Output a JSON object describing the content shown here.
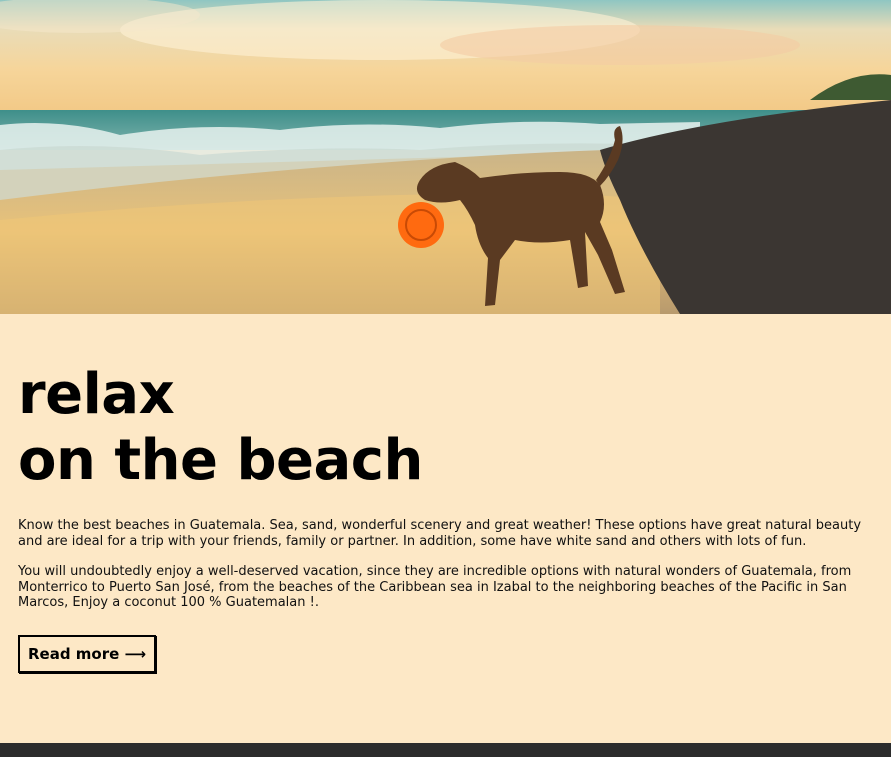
{
  "hero": {
    "image": "beach-dog-frisbee-photo"
  },
  "main": {
    "title_line1": "relax",
    "title_line2": "on the beach",
    "paragraph1": "Know the best beaches in Guatemala. Sea, sand, wonderful scenery and great weather! These options have great natural beauty and are ideal for a trip with your friends, family or partner. In addition, some have white sand and others with lots of fun.",
    "paragraph2": "You will undoubtedly enjoy a well-deserved vacation, since they are incredible options with natural wonders of Guatemala, from Monterrico to Puerto San José, from the beaches of the Caribbean sea in Izabal to the neighboring beaches of the Pacific in San Marcos, Enjoy a coconut 100 % Guatemalan !.",
    "read_more_label": "Read more ⟶"
  },
  "colors": {
    "background": "#fde8c6",
    "footer": "#2c2c2c",
    "text": "#000000"
  }
}
